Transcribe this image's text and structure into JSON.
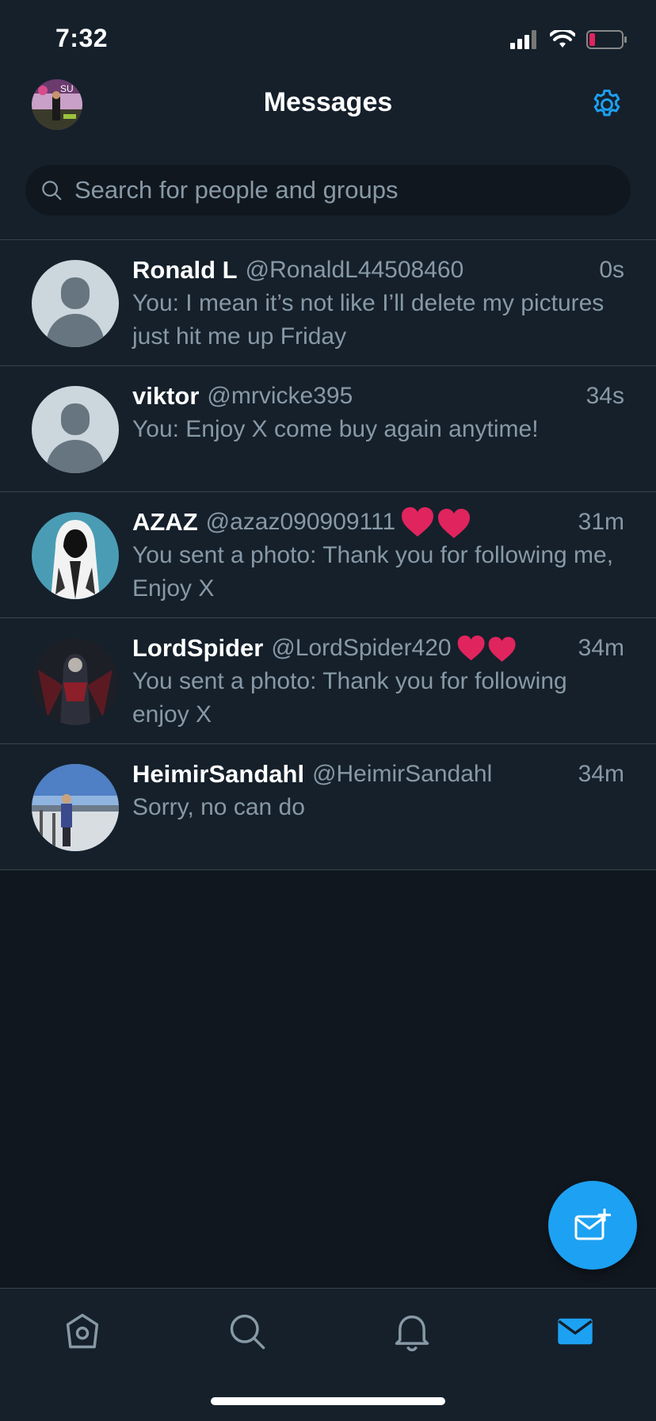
{
  "status_bar": {
    "time": "7:32",
    "icons": [
      "signal-icon",
      "wifi-icon",
      "battery-low-icon"
    ]
  },
  "header": {
    "title": "Messages",
    "avatar_icon": "profile-avatar",
    "avatar_text": "SU",
    "settings_icon": "gear-icon"
  },
  "search": {
    "placeholder": "Search for people and groups",
    "icon": "search-icon"
  },
  "conversations": [
    {
      "name": "Ronald L",
      "handle": "@RonaldL44508460",
      "time": "0s",
      "preview": "You: I mean it’s not like I’ll delete my pictures just hit me up Friday",
      "avatar": "default-avatar"
    },
    {
      "name": "viktor",
      "handle": "@mrvicke395",
      "time": "34s",
      "preview": "You: Enjoy X come buy again anytime!",
      "avatar": "default-avatar"
    },
    {
      "name": "AZAZ",
      "handle": "@azaz090909111",
      "emoji": "two-hearts-icon",
      "time": "31m",
      "preview": "You sent a photo: Thank you for following me, Enjoy X",
      "avatar": "hooded-figure-avatar"
    },
    {
      "name": "LordSpider",
      "handle": "@LordSpider420",
      "emoji": "two-hearts-icon",
      "time": "34m",
      "preview": "You sent a photo: Thank you for following enjoy X",
      "avatar": "dark-character-avatar"
    },
    {
      "name": "HeimirSandahl",
      "handle": "@HeimirSandahl",
      "time": "34m",
      "preview": "Sorry, no can do",
      "avatar": "photo-avatar"
    }
  ],
  "fab": {
    "icon": "new-message-icon"
  },
  "tabs": [
    {
      "icon": "home-icon",
      "active": false
    },
    {
      "icon": "search-icon",
      "active": false
    },
    {
      "icon": "bell-icon",
      "active": false
    },
    {
      "icon": "mail-icon",
      "active": true
    }
  ],
  "colors": {
    "background": "#10171f",
    "surface": "#15202b",
    "accent": "#1da1f2",
    "secondary_text": "#8899a6",
    "divider": "#38444d",
    "heart": "#e0245e"
  }
}
